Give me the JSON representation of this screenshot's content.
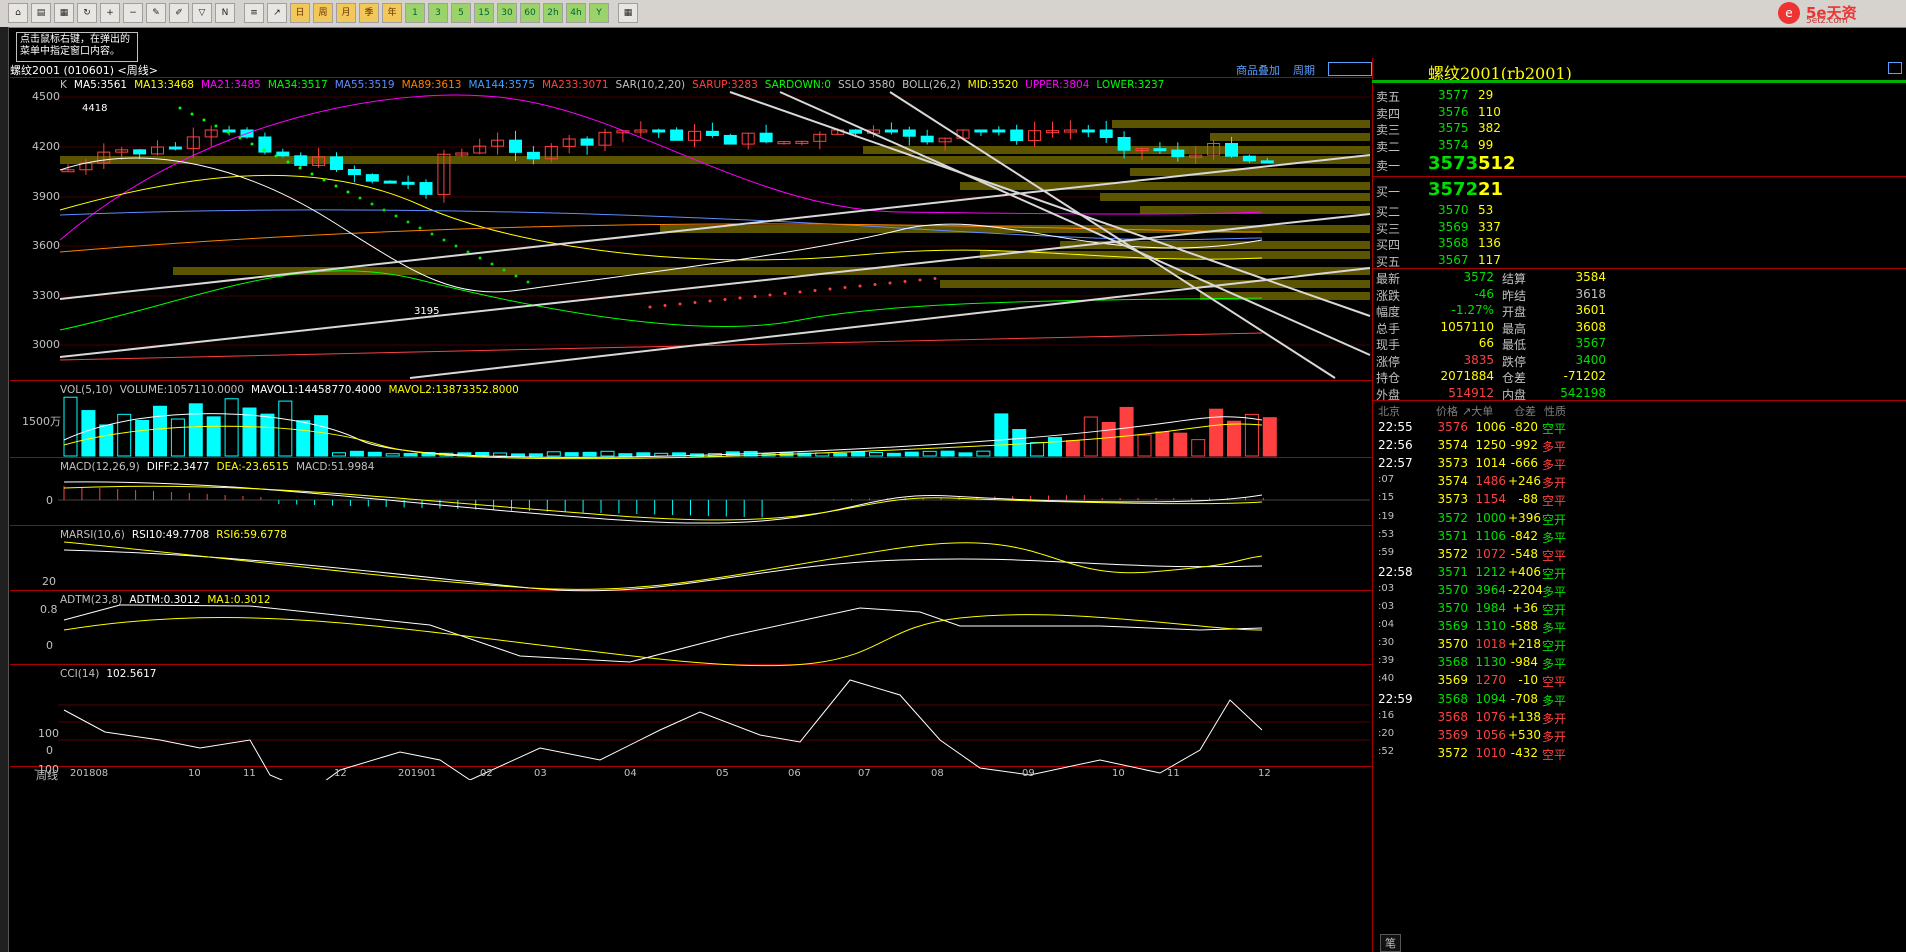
{
  "window": {
    "tip": [
      "点击鼠标右键，在弹出的",
      "菜单中指定窗口内容。"
    ],
    "chart_title": "螺纹2001 (010601) <周线>",
    "link_overlay": "商品叠加",
    "link_period": "周期",
    "logo_main": "5e天资",
    "logo_sub": "5etz.com"
  },
  "toolbar": {
    "icons": [
      "home-icon",
      "folder-icon",
      "chart-icon",
      "refresh-icon",
      "zoom-in-icon",
      "zoom-out-icon",
      "pen-icon",
      "draw-icon",
      "filter-icon",
      "news-icon",
      "table-icon",
      "trend-icon",
      "day-icon",
      "week-icon",
      "month-icon",
      "quarter-icon",
      "year-icon"
    ],
    "period_buttons": [
      "1",
      "3",
      "5",
      "15",
      "30",
      "60",
      "2h",
      "4h",
      "Y"
    ]
  },
  "main_legend": [
    {
      "text": "K",
      "color": "#c0c0c0"
    },
    {
      "text": "MA5:3561",
      "color": "#ffffff"
    },
    {
      "text": "MA13:3468",
      "color": "#ffff00"
    },
    {
      "text": "MA21:3485",
      "color": "#ff00ff"
    },
    {
      "text": "MA34:3517",
      "color": "#00ff00"
    },
    {
      "text": "MA55:3519",
      "color": "#5f8cff"
    },
    {
      "text": "MA89:3613",
      "color": "#ff8000"
    },
    {
      "text": "MA144:3575",
      "color": "#40a0ff"
    },
    {
      "text": "MA233:3071",
      "color": "#ff4040"
    },
    {
      "text": "SAR(10,2,20)",
      "color": "#c0c0c0"
    },
    {
      "text": "SARUP:3283",
      "color": "#ff4040"
    },
    {
      "text": "SARDOWN:0",
      "color": "#00ff00"
    },
    {
      "text": "SSLO 3580",
      "color": "#c0c0c0"
    },
    {
      "text": "BOLL(26,2)",
      "color": "#c0c0c0"
    },
    {
      "text": "MID:3520",
      "color": "#ffff00"
    },
    {
      "text": "UPPER:3804",
      "color": "#ff00ff"
    },
    {
      "text": "LOWER:3237",
      "color": "#00ff00"
    }
  ],
  "price_axis": [
    "4500",
    "4200",
    "3900",
    "3600",
    "3300",
    "3000"
  ],
  "price_annotations": {
    "high": "4418",
    "low": "3195"
  },
  "vol": {
    "legend": [
      {
        "text": "VOL(5,10)",
        "color": "#c0c0c0"
      },
      {
        "text": "VOLUME:1057110.0000",
        "color": "#c0c0c0"
      },
      {
        "text": "MAVOL1:14458770.4000",
        "color": "#ffffff"
      },
      {
        "text": "MAVOL2:13873352.8000",
        "color": "#ffff00"
      }
    ],
    "axis": "1500万"
  },
  "macd": {
    "legend": [
      {
        "text": "MACD(12,26,9)",
        "color": "#c0c0c0"
      },
      {
        "text": "DIFF:2.3477",
        "color": "#ffffff"
      },
      {
        "text": "DEA:-23.6515",
        "color": "#ffff00"
      },
      {
        "text": "MACD:51.9984",
        "color": "#c0c0c0"
      }
    ],
    "axis": "0"
  },
  "marsi": {
    "legend": [
      {
        "text": "MARSI(10,6)",
        "color": "#c0c0c0"
      },
      {
        "text": "RSI10:49.7708",
        "color": "#ffffff"
      },
      {
        "text": "RSI6:59.6778",
        "color": "#ffff00"
      }
    ],
    "axis": "20"
  },
  "adtm": {
    "legend": [
      {
        "text": "ADTM(23,8)",
        "color": "#c0c0c0"
      },
      {
        "text": "ADTM:0.3012",
        "color": "#ffffff"
      },
      {
        "text": "MA1:0.3012",
        "color": "#ffff00"
      }
    ],
    "axis": [
      "0.8",
      "0"
    ]
  },
  "cci": {
    "legend": [
      {
        "text": "CCI(14)",
        "color": "#c0c0c0"
      },
      {
        "text": "102.5617",
        "color": "#ffffff"
      }
    ],
    "axis": [
      "100",
      "0",
      "-100"
    ]
  },
  "x_axis": {
    "label": "周线",
    "ticks": [
      "201808",
      "10",
      "11",
      "12",
      "201901",
      "02",
      "03",
      "04",
      "05",
      "06",
      "07",
      "08",
      "09",
      "10",
      "11",
      "12"
    ]
  },
  "quote": {
    "title": "螺纹2001(rb2001)",
    "asks": [
      {
        "label": "卖五",
        "price": "3577",
        "vol": "29"
      },
      {
        "label": "卖四",
        "price": "3576",
        "vol": "110"
      },
      {
        "label": "卖三",
        "price": "3575",
        "vol": "382"
      },
      {
        "label": "卖二",
        "price": "3574",
        "vol": "99"
      }
    ],
    "ask1": {
      "label": "卖一",
      "price": "3573",
      "vol": "512"
    },
    "bid1": {
      "label": "买一",
      "price": "3572",
      "vol": "21"
    },
    "bids": [
      {
        "label": "买二",
        "price": "3570",
        "vol": "53"
      },
      {
        "label": "买三",
        "price": "3569",
        "vol": "337"
      },
      {
        "label": "买四",
        "price": "3568",
        "vol": "136"
      },
      {
        "label": "买五",
        "price": "3567",
        "vol": "117"
      }
    ],
    "stats": [
      {
        "l1": "最新",
        "v1": "3572",
        "c1": "#00e000",
        "l2": "结算",
        "v2": "3584",
        "c2": "#ffff00"
      },
      {
        "l1": "涨跌",
        "v1": "-46",
        "c1": "#00e000",
        "l2": "昨结",
        "v2": "3618",
        "c2": "#c0c0c0"
      },
      {
        "l1": "幅度",
        "v1": "-1.27%",
        "c1": "#00e000",
        "l2": "开盘",
        "v2": "3601",
        "c2": "#ffff00"
      },
      {
        "l1": "总手",
        "v1": "1057110",
        "c1": "#ffff00",
        "l2": "最高",
        "v2": "3608",
        "c2": "#ffff00"
      },
      {
        "l1": "现手",
        "v1": "66",
        "c1": "#ffff00",
        "l2": "最低",
        "v2": "3567",
        "c2": "#00e000"
      },
      {
        "l1": "涨停",
        "v1": "3835",
        "c1": "#ff4040",
        "l2": "跌停",
        "v2": "3400",
        "c2": "#00e000"
      },
      {
        "l1": "持仓",
        "v1": "2071884",
        "c1": "#ffff00",
        "l2": "仓差",
        "v2": "-71202",
        "c2": "#ffff00"
      },
      {
        "l1": "外盘",
        "v1": "514912",
        "c1": "#ff4040",
        "l2": "内盘",
        "v2": "542198",
        "c2": "#00e000"
      }
    ],
    "tick_header": [
      "北京",
      "价格",
      "↗大单",
      "仓差",
      "性质"
    ],
    "ticks": [
      {
        "t": "22:55",
        "p": "3576",
        "v": "1006",
        "d": "-820",
        "n": "空平",
        "pc": "#ff4040",
        "vc": "#ffff00",
        "nc": "#00e000"
      },
      {
        "t": "22:56",
        "p": "3574",
        "v": "1250",
        "d": "-992",
        "n": "多平",
        "pc": "#ffff00",
        "vc": "#ffff00",
        "nc": "#ff4040"
      },
      {
        "t": "22:57",
        "p": "3573",
        "v": "1014",
        "d": "-666",
        "n": "多平",
        "pc": "#ffff00",
        "vc": "#ffff00",
        "nc": "#ff4040"
      },
      {
        "t": ":07",
        "p": "3574",
        "v": "1486",
        "d": "+246",
        "n": "多开",
        "pc": "#ffff00",
        "vc": "#ff4040",
        "nc": "#ff4040"
      },
      {
        "t": ":15",
        "p": "3573",
        "v": "1154",
        "d": "-88",
        "n": "空平",
        "pc": "#ffff00",
        "vc": "#ff4040",
        "nc": "#ff4040"
      },
      {
        "t": ":19",
        "p": "3572",
        "v": "1000",
        "d": "+396",
        "n": "空开",
        "pc": "#00e000",
        "vc": "#00e000",
        "nc": "#00e000"
      },
      {
        "t": ":53",
        "p": "3571",
        "v": "1106",
        "d": "-842",
        "n": "多平",
        "pc": "#00e000",
        "vc": "#00e000",
        "nc": "#00e000"
      },
      {
        "t": ":59",
        "p": "3572",
        "v": "1072",
        "d": "-548",
        "n": "空平",
        "pc": "#ffff00",
        "vc": "#ff4040",
        "nc": "#ff4040"
      },
      {
        "t": "22:58",
        "p": "3571",
        "v": "1212",
        "d": "+406",
        "n": "空开",
        "pc": "#00e000",
        "vc": "#00e000",
        "nc": "#00e000"
      },
      {
        "t": ":03",
        "p": "3570",
        "v": "3964",
        "d": "-2204",
        "n": "多平",
        "pc": "#00e000",
        "vc": "#00e000",
        "nc": "#00e000"
      },
      {
        "t": ":03",
        "p": "3570",
        "v": "1984",
        "d": "+36",
        "n": "空开",
        "pc": "#00e000",
        "vc": "#00e000",
        "nc": "#00e000"
      },
      {
        "t": ":04",
        "p": "3569",
        "v": "1310",
        "d": "-588",
        "n": "多平",
        "pc": "#00e000",
        "vc": "#00e000",
        "nc": "#00e000"
      },
      {
        "t": ":30",
        "p": "3570",
        "v": "1018",
        "d": "+218",
        "n": "空开",
        "pc": "#ffff00",
        "vc": "#ff4040",
        "nc": "#00e000"
      },
      {
        "t": ":39",
        "p": "3568",
        "v": "1130",
        "d": "-984",
        "n": "多平",
        "pc": "#00e000",
        "vc": "#00e000",
        "nc": "#00e000"
      },
      {
        "t": ":40",
        "p": "3569",
        "v": "1270",
        "d": "-10",
        "n": "空平",
        "pc": "#ffff00",
        "vc": "#ff4040",
        "nc": "#ff4040"
      },
      {
        "t": "22:59",
        "p": "3568",
        "v": "1094",
        "d": "-708",
        "n": "多平",
        "pc": "#00e000",
        "vc": "#00e000",
        "nc": "#00e000"
      },
      {
        "t": ":16",
        "p": "3568",
        "v": "1076",
        "d": "+138",
        "n": "多开",
        "pc": "#ff4040",
        "vc": "#ff4040",
        "nc": "#ff4040"
      },
      {
        "t": ":20",
        "p": "3569",
        "v": "1056",
        "d": "+530",
        "n": "多开",
        "pc": "#ff4040",
        "vc": "#ff4040",
        "nc": "#ff4040"
      },
      {
        "t": ":52",
        "p": "3572",
        "v": "1010",
        "d": "-432",
        "n": "空平",
        "pc": "#ffff00",
        "vc": "#ff4040",
        "nc": "#ff4040"
      }
    ],
    "footer_tab": "笔"
  }
}
